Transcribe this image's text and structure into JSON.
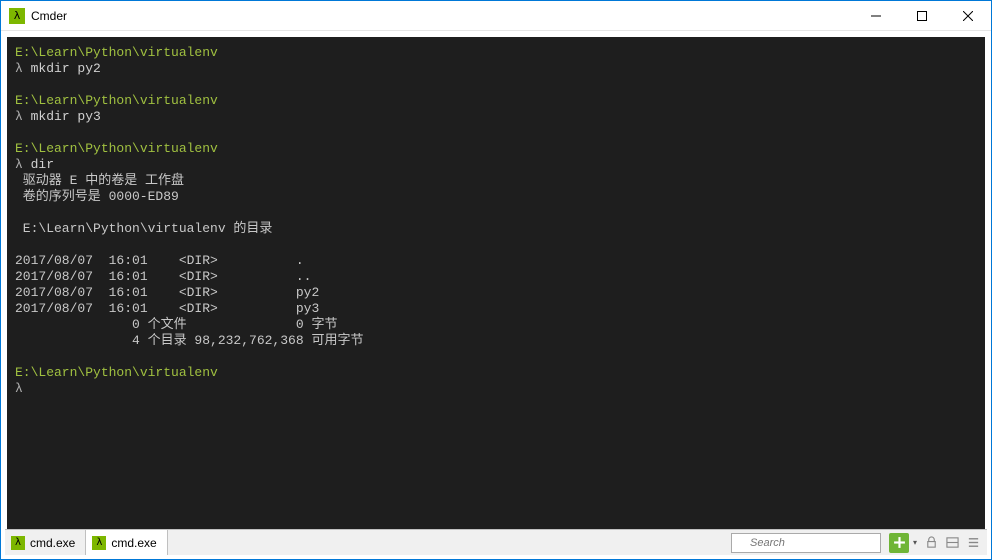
{
  "window": {
    "title": "Cmder",
    "icon": "λ"
  },
  "terminal": {
    "blocks": [
      {
        "path": "E:\\Learn\\Python\\virtualenv",
        "lambda": "λ",
        "cmd": "mkdir py2"
      },
      {
        "path": "E:\\Learn\\Python\\virtualenv",
        "lambda": "λ",
        "cmd": "mkdir py3"
      },
      {
        "path": "E:\\Learn\\Python\\virtualenv",
        "lambda": "λ",
        "cmd": "dir"
      }
    ],
    "dir_output": {
      "vol": " 驱动器 E 中的卷是 工作盘",
      "serial": " 卷的序列号是 0000-ED89",
      "blank1": "",
      "header": " E:\\Learn\\Python\\virtualenv 的目录",
      "blank2": "",
      "rows": [
        "2017/08/07  16:01    <DIR>          .",
        "2017/08/07  16:01    <DIR>          ..",
        "2017/08/07  16:01    <DIR>          py2",
        "2017/08/07  16:01    <DIR>          py3"
      ],
      "files": "               0 个文件              0 字节",
      "dirs": "               4 个目录 98,232,762,368 可用字节"
    },
    "final": {
      "path": "E:\\Learn\\Python\\virtualenv",
      "lambda": "λ"
    }
  },
  "tabs": [
    {
      "icon": "λ",
      "label": "cmd.exe"
    },
    {
      "icon": "λ",
      "label": "cmd.exe"
    }
  ],
  "search": {
    "placeholder": "Search"
  }
}
